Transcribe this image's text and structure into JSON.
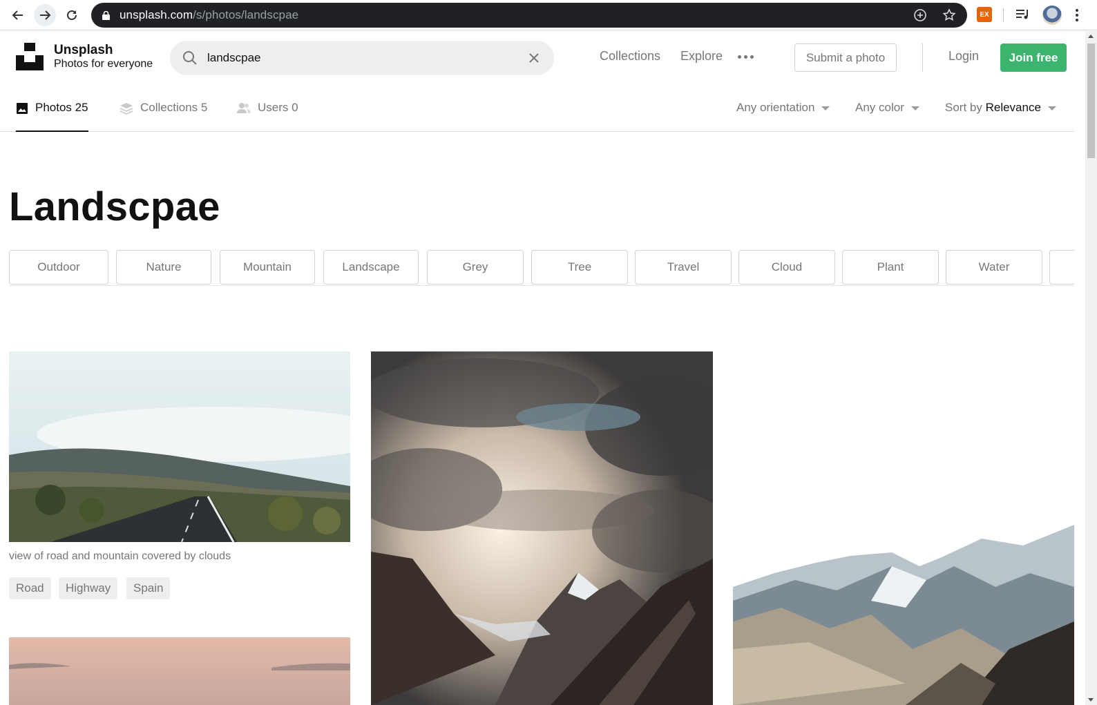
{
  "browser": {
    "url_host": "unsplash.com",
    "url_path": "/s/photos/landscpae",
    "extension_badge": "EX"
  },
  "brand": {
    "title": "Unsplash",
    "subtitle": "Photos for everyone"
  },
  "search": {
    "value": "landscpae"
  },
  "topnav": {
    "collections": "Collections",
    "explore": "Explore",
    "submit": "Submit a photo",
    "login": "Login",
    "join": "Join free"
  },
  "tabs": [
    {
      "label": "Photos 25",
      "active": true
    },
    {
      "label": "Collections 5",
      "active": false
    },
    {
      "label": "Users 0",
      "active": false
    }
  ],
  "filters": {
    "orientation": "Any orientation",
    "color": "Any color",
    "sort_prefix": "Sort by",
    "sort_value": "Relevance"
  },
  "page_title": "Landscpae",
  "related": [
    "Outdoor",
    "Nature",
    "Mountain",
    "Landscape",
    "Grey",
    "Tree",
    "Travel",
    "Cloud",
    "Plant",
    "Water"
  ],
  "photos": [
    {
      "caption": "view of road and mountain covered by clouds",
      "tags": [
        "Road",
        "Highway",
        "Spain"
      ]
    }
  ],
  "colors": {
    "accent_green": "#3cb46e",
    "muted_text": "#767676",
    "chrome_dark": "#202124"
  }
}
